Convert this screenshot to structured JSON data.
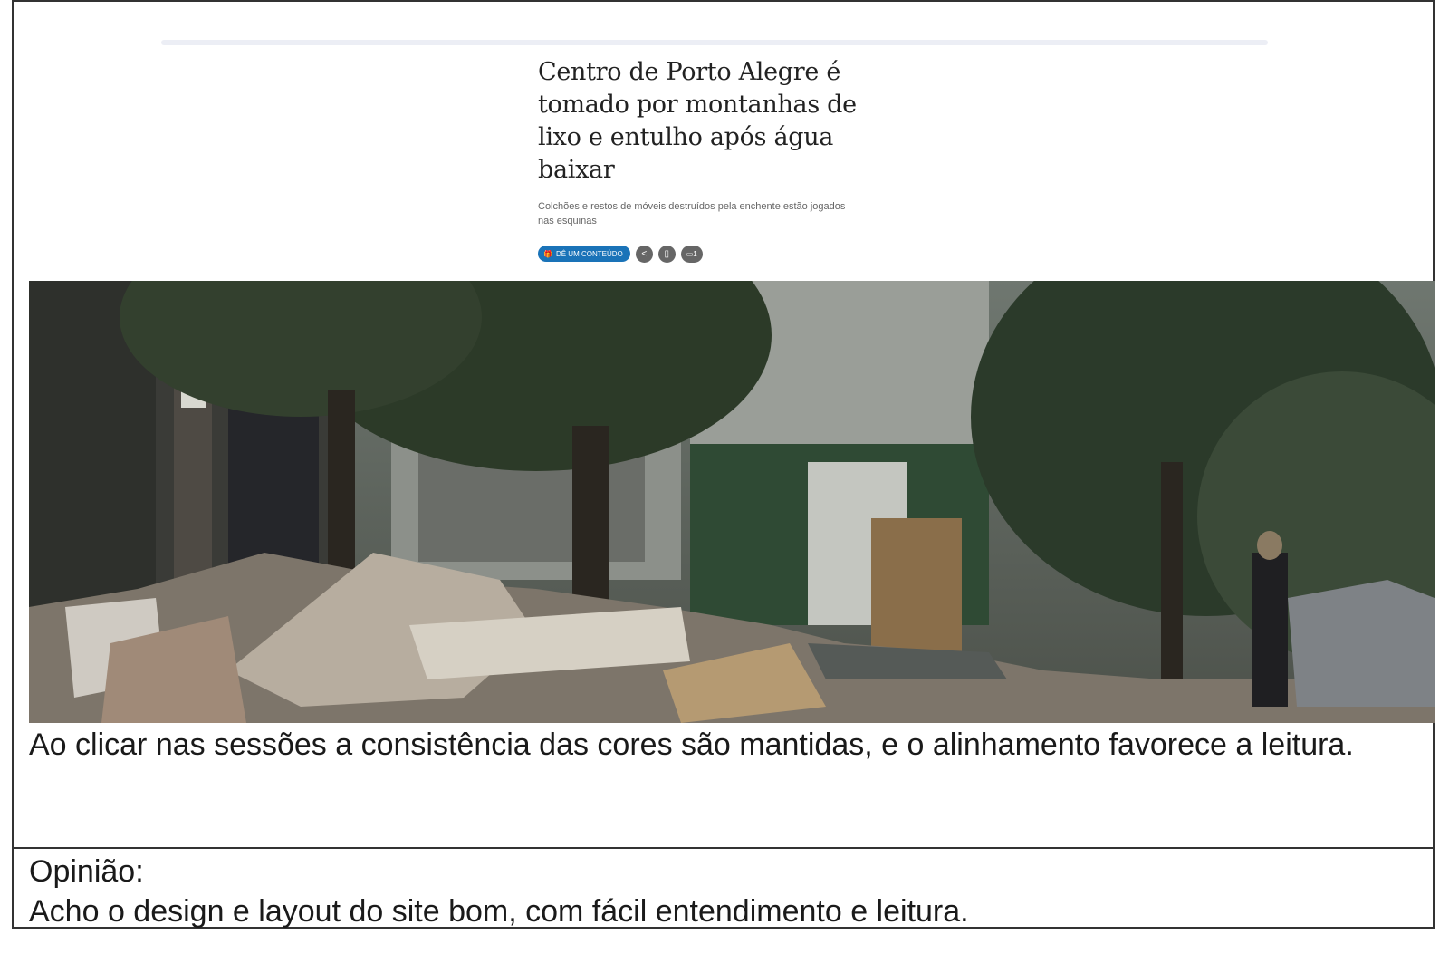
{
  "article": {
    "headline": "Centro de Porto Alegre é tomado por montanhas de lixo e entulho após água baixar",
    "subtitle": "Colchões e restos de móveis destruídos pela enchente estão jogados nas esquinas",
    "gift_button_label": "Dê um conteúdo",
    "comment_count": "1",
    "photo_icon": "flood-debris-street-photo"
  },
  "caption": "Ao clicar nas sessões a consistência das cores são mantidas, e o alinhamento favorece a leitura.",
  "opinion": {
    "label": "Opinião:",
    "text": "Acho o design e layout do site bom, com fácil entendimento e leitura."
  },
  "colors": {
    "accent": "#1a73b8",
    "icon_grey": "#666666",
    "border": "#333333"
  }
}
